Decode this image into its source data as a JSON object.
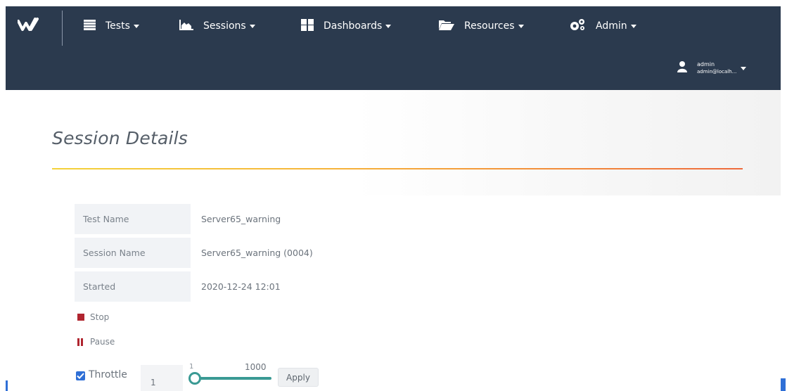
{
  "nav": {
    "items": [
      {
        "label": "Tests",
        "icon": "list-icon"
      },
      {
        "label": "Sessions",
        "icon": "area-chart-icon"
      },
      {
        "label": "Dashboards",
        "icon": "grid-icon"
      },
      {
        "label": "Resources",
        "icon": "folder-open-icon"
      },
      {
        "label": "Admin",
        "icon": "cogs-icon"
      }
    ],
    "logo_icon": "w-logo-icon",
    "user": {
      "name": "admin",
      "email": "admin@localh...",
      "icon": "user-icon"
    }
  },
  "page": {
    "title": "Session Details"
  },
  "details": [
    {
      "label": "Test Name",
      "value": "Server65_warning"
    },
    {
      "label": "Session Name",
      "value": "Server65_warning (0004)"
    },
    {
      "label": "Started",
      "value": "2020-12-24 12:01"
    }
  ],
  "controls": {
    "stop_label": "Stop",
    "pause_label": "Pause"
  },
  "throttle": {
    "checked": true,
    "label": "Throttle",
    "value": "1",
    "slider_min": "1",
    "slider_max": "1000",
    "apply_label": "Apply"
  },
  "colors": {
    "navbar": "#2b3a4e",
    "accent_stop": "#b0252f",
    "slider": "#3a9a94",
    "checkbox": "#2f6fd6"
  }
}
